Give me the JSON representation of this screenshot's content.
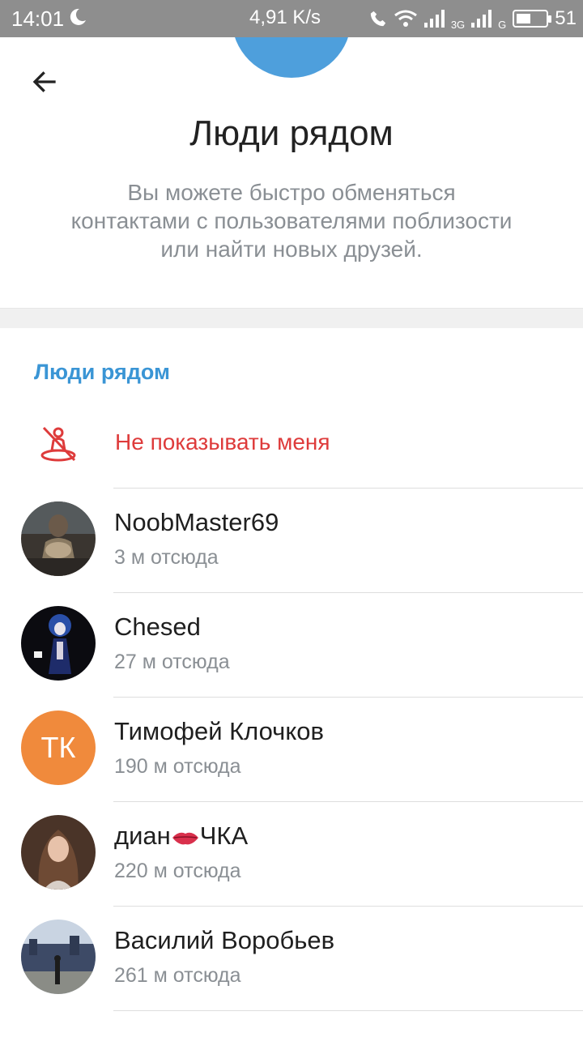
{
  "status_bar": {
    "time": "14:01",
    "net_speed": "4,91 K/s",
    "network_3g": "3G",
    "network_g": "G",
    "battery_level": "51",
    "battery_fill_fraction": 0.51
  },
  "header": {
    "title": "Люди рядом",
    "description": "Вы можете быстро обменяться контактами с пользователями поблизости или найти новых друзей."
  },
  "section": {
    "title": "Люди рядом",
    "hide_me_label": "Не показывать меня"
  },
  "people": [
    {
      "name": "NoobMaster69",
      "distance": "3 м отсюда",
      "avatar": "photo-dark-bearded-man"
    },
    {
      "name": "Chesed",
      "distance": "27 м отсюда",
      "avatar": "illustration-blue-hair"
    },
    {
      "name": "Тимофей Клочков",
      "distance": "190 м отсюда",
      "avatar_initials": "ТК",
      "avatar_color": "#f08a3c"
    },
    {
      "name_before": "диан",
      "name_emoji": "lips-emoji",
      "name_after": "ЧКА",
      "distance": "220 м отсюда",
      "avatar": "photo-girl-long-hair"
    },
    {
      "name": "Василий Воробьев",
      "distance": "261 м отсюда",
      "avatar": "photo-man-outdoors-building"
    }
  ],
  "colors": {
    "accent": "#3a95d5",
    "danger": "#de3b3b",
    "secondary_text": "#8a8f94",
    "bubble": "#4e9fdc"
  }
}
